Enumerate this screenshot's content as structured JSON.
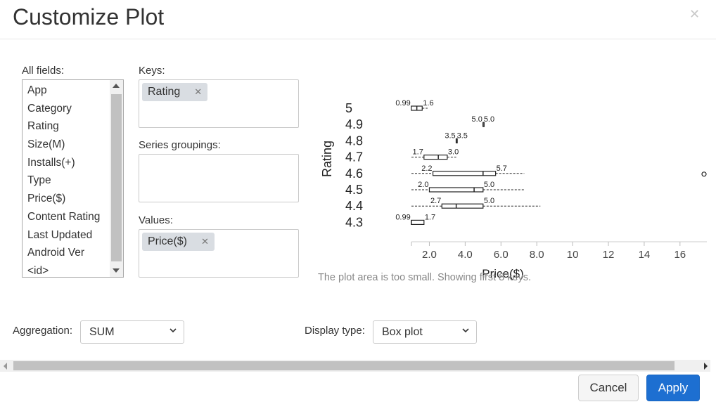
{
  "dialog": {
    "title": "Customize Plot"
  },
  "fields": {
    "label": "All fields:",
    "items": [
      "App",
      "Category",
      "Rating",
      "Size(M)",
      "Installs(+)",
      "Type",
      "Price($)",
      "Content Rating",
      "Last Updated",
      "Android Ver",
      "<id>"
    ]
  },
  "keys": {
    "label": "Keys:",
    "chips": [
      "Rating"
    ]
  },
  "series_groupings": {
    "label": "Series groupings:"
  },
  "values": {
    "label": "Values:",
    "chips": [
      "Price($)"
    ]
  },
  "aggregation": {
    "label": "Aggregation:",
    "selected": "SUM"
  },
  "display_type": {
    "label": "Display type:",
    "selected": "Box plot"
  },
  "plot": {
    "note": "The plot area is too small. Showing first 8 keys."
  },
  "buttons": {
    "cancel": "Cancel",
    "apply": "Apply"
  },
  "chart_data": {
    "type": "box",
    "orientation": "horizontal",
    "xlabel": "Price($)",
    "ylabel": "Rating",
    "categories": [
      "5",
      "4.9",
      "4.8",
      "4.7",
      "4.6",
      "4.5",
      "4.4",
      "4.3"
    ],
    "x_ticks": [
      "2.0",
      "4.0",
      "6.0",
      "8.0",
      "10",
      "12",
      "14",
      "16"
    ],
    "xlim": [
      1,
      17.5
    ],
    "boxes": [
      {
        "category": "5",
        "q1": 0.99,
        "median": 1.3,
        "q3": 1.6,
        "whisker_low": 0.99,
        "whisker_high": 1.9,
        "q1_label": "0.99",
        "q3_label": "1.6"
      },
      {
        "category": "4.9",
        "q1": 5.0,
        "median": 5.0,
        "q3": 5.0,
        "whisker_low": 5.0,
        "whisker_high": 5.0,
        "q1_label": "5.0",
        "q3_label": "5.0"
      },
      {
        "category": "4.8",
        "q1": 3.5,
        "median": 3.5,
        "q3": 3.5,
        "whisker_low": 3.5,
        "whisker_high": 3.5,
        "q1_label": "3.5",
        "q3_label": "3.5"
      },
      {
        "category": "4.7",
        "q1": 1.7,
        "median": 2.5,
        "q3": 3.0,
        "whisker_low": 1.0,
        "whisker_high": 3.5,
        "q1_label": "1.7",
        "q3_label": "3.0"
      },
      {
        "category": "4.6",
        "q1": 2.2,
        "median": 5.0,
        "q3": 5.7,
        "whisker_low": 1.0,
        "whisker_high": 7.3,
        "q1_label": "2.2",
        "q3_label": "5.7"
      },
      {
        "category": "4.5",
        "q1": 2.0,
        "median": 4.5,
        "q3": 5.0,
        "whisker_low": 1.0,
        "whisker_high": 7.3,
        "q1_label": "2.0",
        "q3_label": "5.0"
      },
      {
        "category": "4.4",
        "q1": 2.7,
        "median": 3.5,
        "q3": 5.0,
        "whisker_low": 1.0,
        "whisker_high": 8.2,
        "q1_label": "2.7",
        "q3_label": "5.0"
      },
      {
        "category": "4.3",
        "q1": 0.99,
        "median": 0.99,
        "q3": 1.7,
        "whisker_low": 0.99,
        "whisker_high": 1.7,
        "q1_label": "0.99",
        "q3_label": "1.7"
      }
    ],
    "outliers": [
      {
        "category": "4.6",
        "x": 17.5
      }
    ]
  }
}
